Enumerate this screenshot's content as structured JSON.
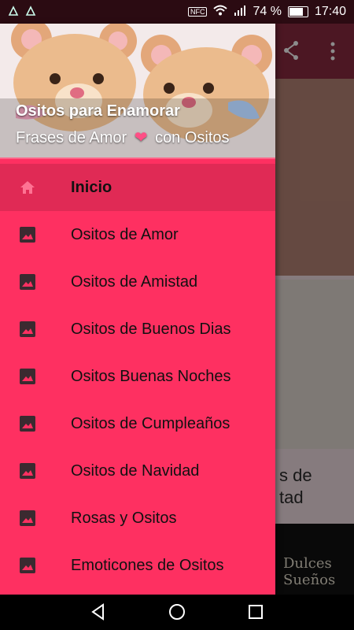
{
  "status_bar": {
    "battery_percent": "74 %",
    "time": "17:40",
    "nfc": "NFC"
  },
  "background": {
    "card_text": "s de\ntad",
    "card3_text": "Dulces Sueños"
  },
  "drawer": {
    "header": {
      "title": "Ositos para Enamorar",
      "subtitle_left": "Frases de Amor",
      "subtitle_right": "con Ositos"
    },
    "items": [
      {
        "label": "Inicio",
        "icon": "home-icon",
        "active": true
      },
      {
        "label": "Ositos de Amor",
        "icon": "image-icon"
      },
      {
        "label": "Ositos de Amistad",
        "icon": "image-icon"
      },
      {
        "label": "Ositos de Buenos Dias",
        "icon": "image-icon"
      },
      {
        "label": "Ositos Buenas Noches",
        "icon": "image-icon"
      },
      {
        "label": "Ositos de Cumpleaños",
        "icon": "image-icon"
      },
      {
        "label": "Ositos de Navidad",
        "icon": "image-icon"
      },
      {
        "label": "Rosas y Ositos",
        "icon": "image-icon"
      },
      {
        "label": "Emoticones de Ositos",
        "icon": "image-icon"
      }
    ]
  },
  "colors": {
    "drawer_bg": "#fe3061",
    "active_item_bg": "#e02a55",
    "status_bar_bg": "#2b0b12"
  }
}
